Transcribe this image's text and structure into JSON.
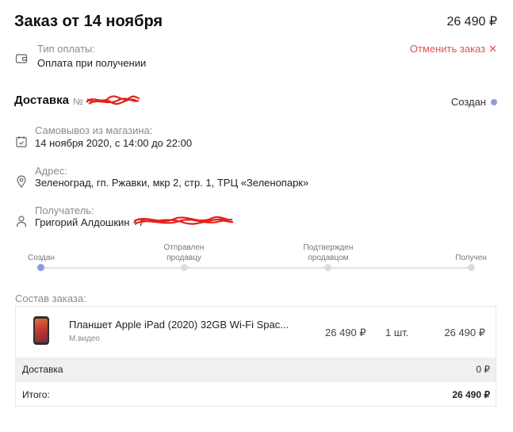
{
  "order": {
    "title": "Заказ от 14 ноября",
    "total": "26 490 ₽",
    "payment_label": "Тип оплаты:",
    "payment_value": "Оплата при получении",
    "cancel_label": "Отменить заказ",
    "cancel_icon": "✕"
  },
  "delivery": {
    "title": "Доставка",
    "number_prefix": "№",
    "status": "Создан",
    "pickup_label": "Самовывоз из магазина:",
    "pickup_value": "14 ноября 2020, с 14:00 до 22:00",
    "address_label": "Адрес:",
    "address_value": "Зеленоград, гп. Ржавки, мкр 2, стр. 1, ТРЦ «Зеленопарк»",
    "recipient_label": "Получатель:",
    "recipient_value": "Григорий Алдошкин +7"
  },
  "progress": {
    "steps": [
      {
        "label": "Создан"
      },
      {
        "label": "Отправлен продавцу"
      },
      {
        "label": "Подтвержден продавцом"
      },
      {
        "label": "Получен"
      }
    ],
    "current_step": 0
  },
  "composition": {
    "label": "Состав заказа:",
    "item": {
      "name": "Планшет Apple iPad (2020) 32GB Wi-Fi Spac...",
      "seller": "М.видео",
      "price": "26 490 ₽",
      "qty": "1 шт.",
      "sum": "26 490 ₽"
    },
    "delivery_label": "Доставка",
    "delivery_price": "0 ₽",
    "total_label": "Итого:",
    "total_value": "26 490 ₽"
  },
  "colors": {
    "accent": "#8f98e4",
    "cancel": "#e0524f",
    "redaction": "#e3221c"
  }
}
